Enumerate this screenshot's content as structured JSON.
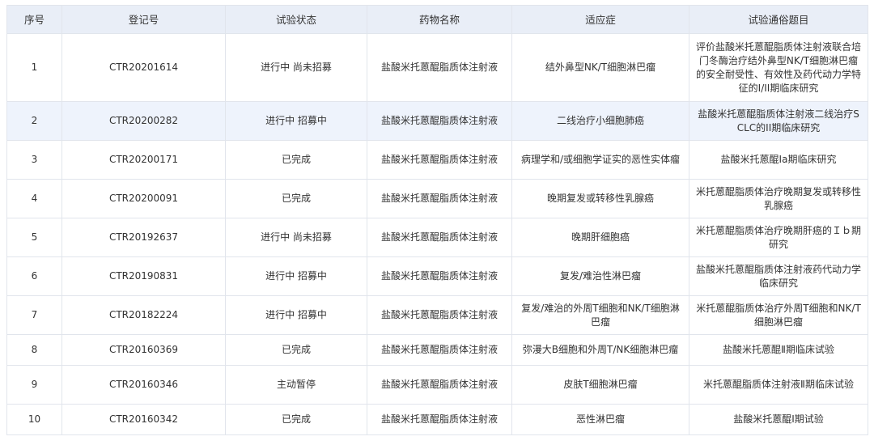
{
  "table": {
    "headers": [
      "序号",
      "登记号",
      "试验状态",
      "药物名称",
      "适应症",
      "试验通俗题目"
    ],
    "rows": [
      {
        "index": "1",
        "reg": "CTR20201614",
        "status": "进行中 尚未招募",
        "drug": "盐酸米托蒽醌脂质体注射液",
        "indication": "结外鼻型NK/T细胞淋巴瘤",
        "title": "评价盐酸米托蒽醌脂质体注射液联合培门冬酶治疗结外鼻型NK/T细胞淋巴瘤的安全耐受性、有效性及药代动力学特征的I/II期临床研究"
      },
      {
        "index": "2",
        "reg": "CTR20200282",
        "status": "进行中 招募中",
        "drug": "盐酸米托蒽醌脂质体注射液",
        "indication": "二线治疗小细胞肺癌",
        "title": "盐酸米托蒽醌脂质体注射液二线治疗SCLC的II期临床研究"
      },
      {
        "index": "3",
        "reg": "CTR20200171",
        "status": "已完成",
        "drug": "盐酸米托蒽醌脂质体注射液",
        "indication": "病理学和/或细胞学证实的恶性实体瘤",
        "title": "盐酸米托蒽醌Ia期临床研究"
      },
      {
        "index": "4",
        "reg": "CTR20200091",
        "status": "已完成",
        "drug": "盐酸米托蒽醌脂质体注射液",
        "indication": "晚期复发或转移性乳腺癌",
        "title": "米托蒽醌脂质体治疗晚期复发或转移性乳腺癌"
      },
      {
        "index": "5",
        "reg": "CTR20192637",
        "status": "进行中 尚未招募",
        "drug": "盐酸米托蒽醌脂质体注射液",
        "indication": "晚期肝细胞癌",
        "title": "米托蒽醌脂质体治疗晚期肝癌的Ｉｂ期研究"
      },
      {
        "index": "6",
        "reg": "CTR20190831",
        "status": "进行中 招募中",
        "drug": "盐酸米托蒽醌脂质体注射液",
        "indication": "复发/难治性淋巴瘤",
        "title": "盐酸米托蒽醌脂质体注射液药代动力学临床研究"
      },
      {
        "index": "7",
        "reg": "CTR20182224",
        "status": "进行中 招募中",
        "drug": "盐酸米托蒽醌脂质体注射液",
        "indication": "复发/难治的外周T细胞和NK/T细胞淋巴瘤",
        "title": "米托蒽醌脂质体治疗外周T细胞和NK/T细胞淋巴瘤"
      },
      {
        "index": "8",
        "reg": "CTR20160369",
        "status": "已完成",
        "drug": "盐酸米托蒽醌脂质体注射液",
        "indication": "弥漫大B细胞和外周T/NK细胞淋巴瘤",
        "title": "盐酸米托蒽醌Ⅱ期临床试验"
      },
      {
        "index": "9",
        "reg": "CTR20160346",
        "status": "主动暂停",
        "drug": "盐酸米托蒽醌脂质体注射液",
        "indication": "皮肤T细胞淋巴瘤",
        "title": "米托蒽醌脂质体注射液Ⅱ期临床试验"
      },
      {
        "index": "10",
        "reg": "CTR20160342",
        "status": "已完成",
        "drug": "盐酸米托蒽醌脂质体注射液",
        "indication": "恶性淋巴瘤",
        "title": "盐酸米托蒽醌Ⅰ期试验"
      }
    ]
  },
  "colors": {
    "header_bg": "#e9eef7",
    "highlight_row_bg": "#eef3fc",
    "border": "#e1e5ec",
    "text": "#333333"
  }
}
